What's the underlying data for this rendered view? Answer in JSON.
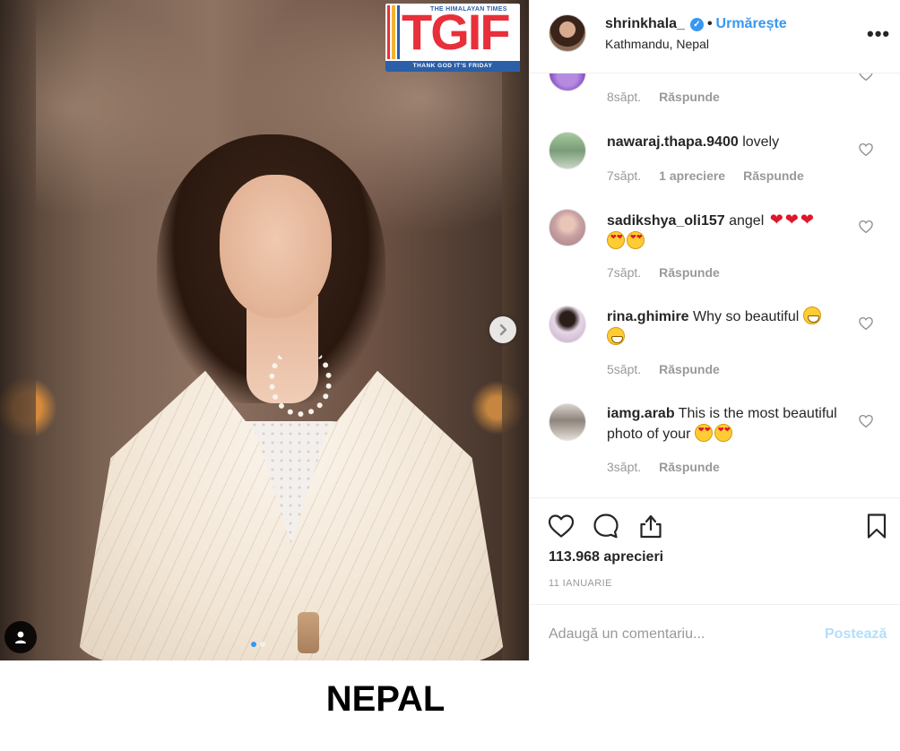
{
  "post": {
    "photo": {
      "logo": {
        "top_text": "THE HIMALAYAN TIMES",
        "main_text": "TGIF",
        "tagline": "THANK GOD IT'S FRIDAY",
        "bar_colors": [
          "#e8303a",
          "#f2b233",
          "#2b5fa8"
        ]
      },
      "carousel": {
        "total_slides": 2,
        "active_slide": 1
      }
    },
    "caption_below": "NEPAL",
    "header": {
      "username": "shrinkhala_",
      "verified": true,
      "separator": "•",
      "follow_label": "Urmărește",
      "location": "Kathmandu, Nepal",
      "more_icon": "more-options-icon"
    },
    "comments": [
      {
        "username": "",
        "text": "",
        "time": "8săpt.",
        "likes_label": "",
        "reply_label": "Răspunde"
      },
      {
        "username": "nawaraj.thapa.9400",
        "text": "lovely",
        "time": "7săpt.",
        "likes_label": "1 apreciere",
        "reply_label": "Răspunde"
      },
      {
        "username": "sadikshya_oli157",
        "text": "angel",
        "emoji": [
          "red-heart",
          "red-heart",
          "red-heart",
          "heart-eyes",
          "heart-eyes"
        ],
        "time": "7săpt.",
        "likes_label": "",
        "reply_label": "Răspunde"
      },
      {
        "username": "rina.ghimire",
        "text": "Why so beautiful",
        "emoji": [
          "grinning",
          "grinning"
        ],
        "time": "5săpt.",
        "likes_label": "",
        "reply_label": "Răspunde"
      },
      {
        "username": "iamg.arab",
        "text": "This is the most beautiful photo of your",
        "emoji": [
          "heart-eyes",
          "heart-eyes"
        ],
        "time": "3săpt.",
        "likes_label": "",
        "reply_label": "Răspunde"
      }
    ],
    "actions": {
      "likes": "113.968 aprecieri",
      "date": "11 IANUARIE"
    },
    "add_comment": {
      "placeholder": "Adaugă un comentariu...",
      "post_label": "Postează"
    },
    "colors": {
      "link_blue": "#3897f0",
      "muted_text": "#999999",
      "post_disabled": "#b2dffc",
      "logo_red": "#e8303a",
      "logo_blue": "#2b5fa8"
    }
  }
}
